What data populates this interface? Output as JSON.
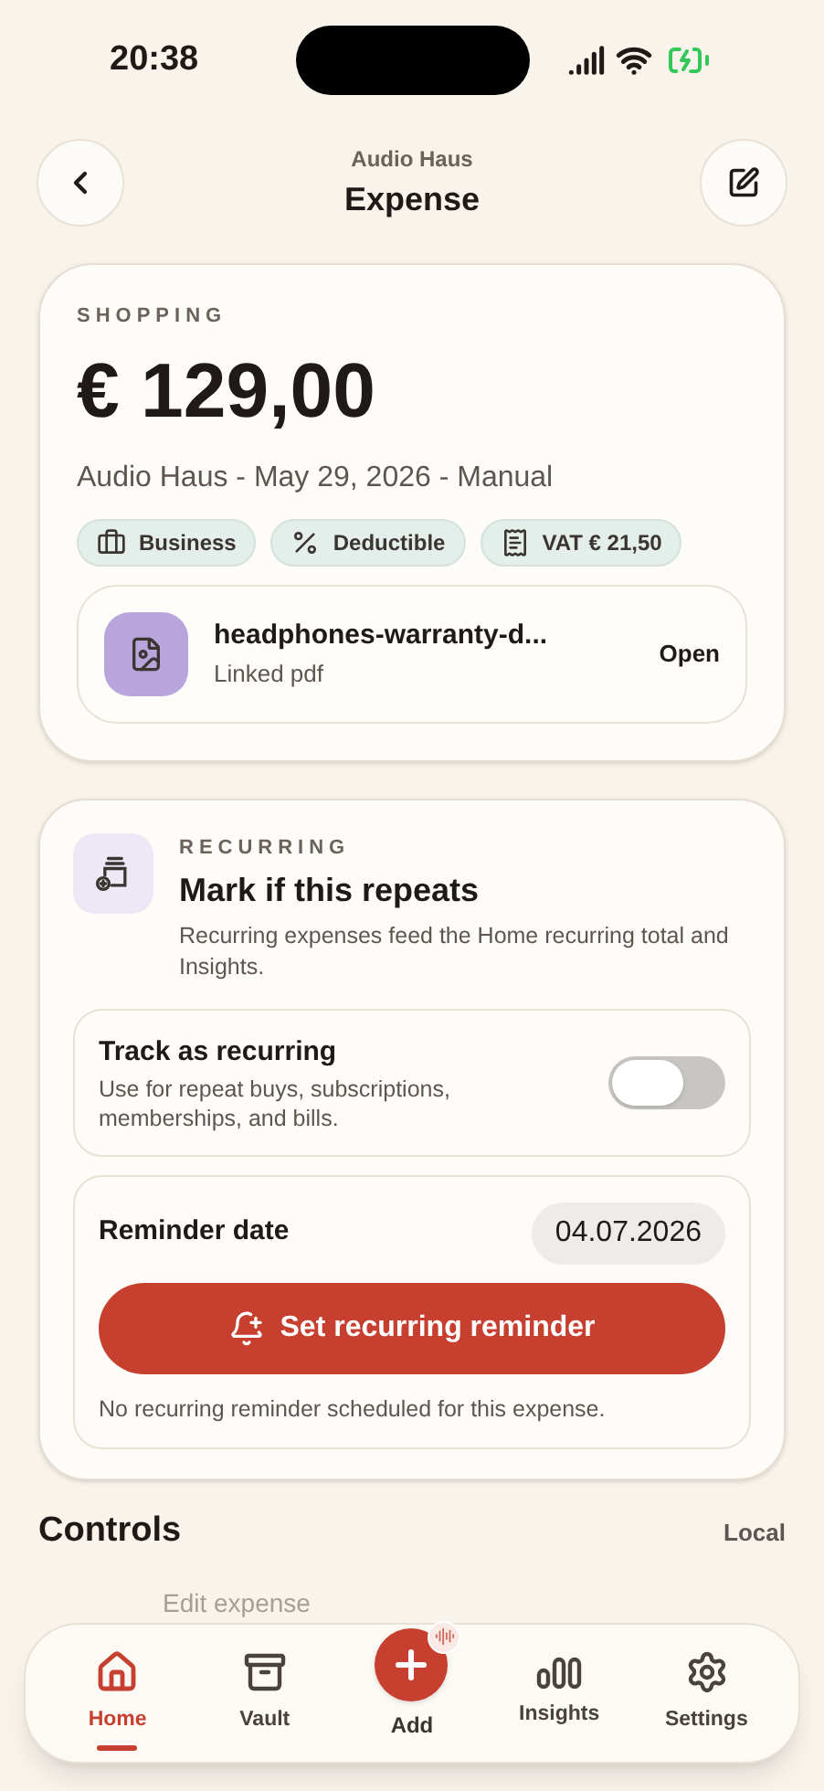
{
  "status_bar": {
    "time": "20:38"
  },
  "header": {
    "subtitle": "Audio Haus",
    "title": "Expense"
  },
  "expense": {
    "category": "SHOPPING",
    "amount": "€ 129,00",
    "meta": "Audio Haus - May 29, 2026 - Manual",
    "tags": [
      {
        "kind": "briefcase",
        "label": "Business"
      },
      {
        "kind": "percent",
        "label": "Deductible"
      },
      {
        "kind": "receipt",
        "label": "VAT € 21,50"
      }
    ],
    "attachment": {
      "name": "headphones-warranty-d...",
      "type": "Linked pdf",
      "action": "Open"
    }
  },
  "recurring": {
    "eyebrow": "RECURRING",
    "title": "Mark if this repeats",
    "description": "Recurring expenses feed the Home recurring total and Insights.",
    "toggle": {
      "label": "Track as recurring",
      "hint": "Use for repeat buys, subscriptions, memberships, and bills.",
      "on": false
    },
    "reminder": {
      "label": "Reminder date",
      "date": "04.07.2026",
      "button": "Set recurring reminder",
      "note": "No recurring reminder scheduled for this expense."
    }
  },
  "controls": {
    "title": "Controls",
    "badge": "Local",
    "first_item": "Edit expense"
  },
  "tab_bar": [
    {
      "kind": "home",
      "label": "Home",
      "selected": true
    },
    {
      "kind": "vault",
      "label": "Vault",
      "selected": false
    },
    {
      "kind": "add",
      "label": "Add",
      "selected": false
    },
    {
      "kind": "insights",
      "label": "Insights",
      "selected": false
    },
    {
      "kind": "settings",
      "label": "Settings",
      "selected": false
    }
  ]
}
